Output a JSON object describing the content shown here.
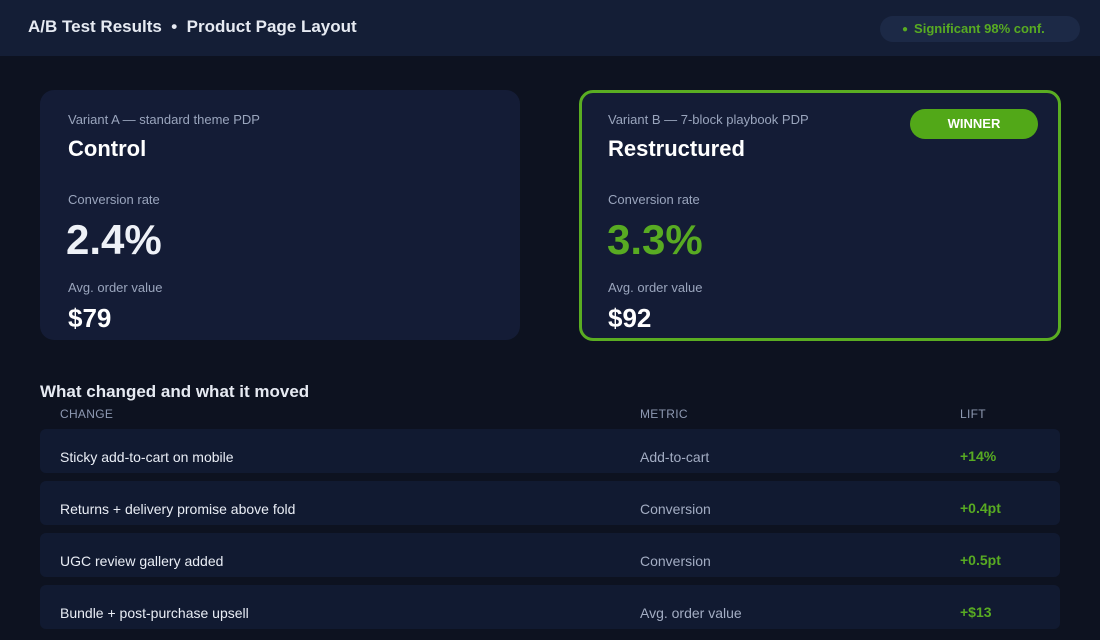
{
  "header": {
    "title": "A/B Test Results  •  Product Page Layout",
    "significance_badge": "Significant 98% conf.",
    "badge_dot": "●"
  },
  "variants": [
    {
      "subtitle": "Variant A — standard theme PDP",
      "name": "Control",
      "conversion_label": "Conversion rate",
      "conversion_value": "2.4%",
      "aov_label": "Avg. order value",
      "aov_value": "$79"
    },
    {
      "subtitle": "Variant B — 7-block playbook PDP",
      "name": "Restructured",
      "conversion_label": "Conversion rate",
      "conversion_value": "3.3%",
      "aov_label": "Avg. order value",
      "aov_value": "$92",
      "winner_label": "WINNER"
    }
  ],
  "changes": {
    "title": "What changed and what it moved",
    "columns": [
      "CHANGE",
      "METRIC",
      "LIFT"
    ],
    "rows": [
      {
        "change": "Sticky add-to-cart on mobile",
        "metric": "Add-to-cart",
        "lift": "+14%"
      },
      {
        "change": "Returns + delivery promise above fold",
        "metric": "Conversion",
        "lift": "+0.4pt"
      },
      {
        "change": "UGC review gallery added",
        "metric": "Conversion",
        "lift": "+0.5pt"
      },
      {
        "change": "Bundle + post-purchase upsell",
        "metric": "Avg. order value",
        "lift": "+$13"
      }
    ]
  },
  "colors": {
    "accent_green": "#58ab22",
    "background": "#0d1220",
    "card": "#141c36",
    "header_bar": "#141e36"
  }
}
